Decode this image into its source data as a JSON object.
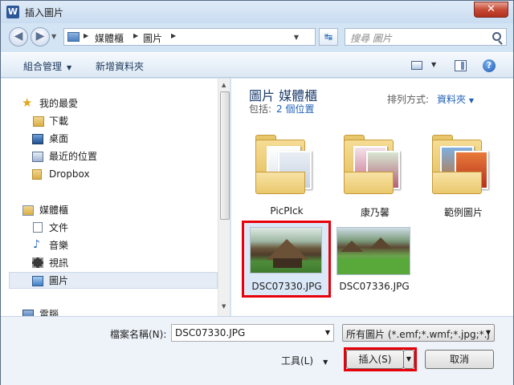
{
  "window": {
    "title": "插入圖片",
    "app_icon": "W",
    "close_label": "✕"
  },
  "address": {
    "crumbs": [
      "媒體櫃",
      "圖片"
    ],
    "search_placeholder": "搜尋 圖片"
  },
  "toolbar": {
    "organize": "組合管理",
    "new_folder": "新增資料夾"
  },
  "nav": {
    "favorites": "我的最愛",
    "fav_items": [
      "下載",
      "桌面",
      "最近的位置",
      "Dropbox"
    ],
    "libraries": "媒體櫃",
    "lib_items": [
      "文件",
      "音樂",
      "視訊",
      "圖片"
    ],
    "computer": "電腦"
  },
  "content": {
    "title": "圖片 媒體櫃",
    "includes_label": "包括:",
    "includes_link": "2 個位置",
    "arrange_label": "排列方式:",
    "arrange_value": "資料夾",
    "folders": [
      "PicPIck",
      "康乃馨",
      "範例圖片"
    ],
    "files": [
      "DSC07330.JPG",
      "DSC07336.JPG"
    ]
  },
  "bottom": {
    "filename_label": "檔案名稱(N):",
    "filename_value": "DSC07330.JPG",
    "filetype_value": "所有圖片 (*.emf;*.wmf;*.jpg;*.j",
    "tools_label": "工具(L)",
    "insert_label": "插入(S)",
    "cancel_label": "取消"
  },
  "colors": {
    "highlight": "#e8000b",
    "link": "#1f5fb8",
    "title_blue": "#1e3d6e"
  }
}
